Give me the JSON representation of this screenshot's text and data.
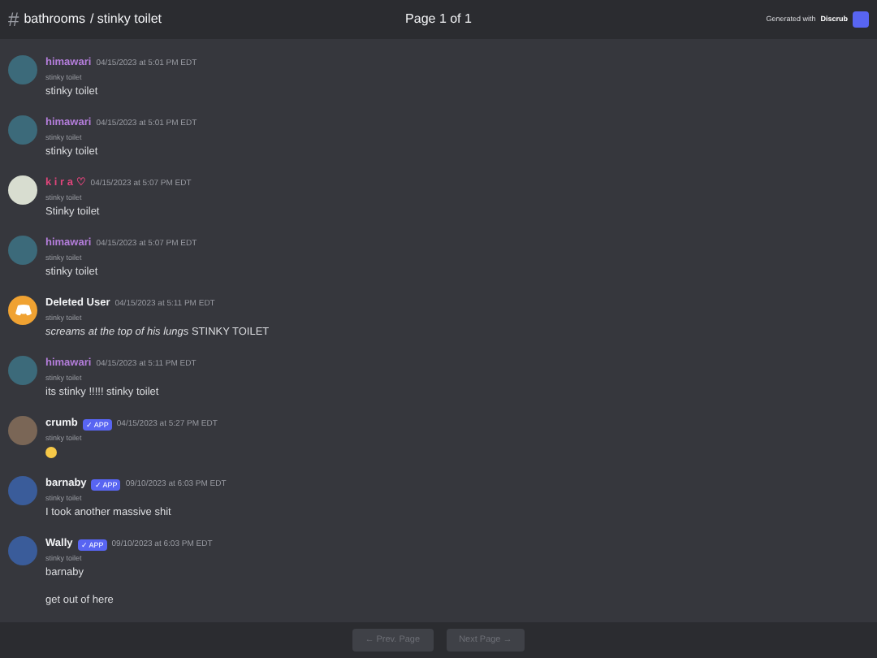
{
  "header": {
    "channel": "bathrooms",
    "thread": "/ stinky toilet",
    "hash": "#",
    "page": "Page 1 of 1",
    "generated": "Generated with",
    "brand": "Discrub"
  },
  "messages": [
    {
      "author": "himawari",
      "color": "#b57edc",
      "kind": "palm",
      "app": false,
      "time": "04/15/2023 at 5:01 PM EDT",
      "reply": "stinky toilet",
      "lines": [
        "stinky toilet"
      ]
    },
    {
      "author": "himawari",
      "color": "#b57edc",
      "kind": "palm",
      "app": false,
      "time": "04/15/2023 at 5:01 PM EDT",
      "reply": "stinky toilet",
      "lines": [
        "stinky toilet"
      ]
    },
    {
      "author": "k i r a ♡",
      "color": "#e0457b",
      "kind": "light",
      "app": false,
      "time": "04/15/2023 at 5:07 PM EDT",
      "reply": "stinky toilet",
      "lines": [
        "Stinky toilet"
      ]
    },
    {
      "author": "himawari",
      "color": "#b57edc",
      "kind": "palm",
      "app": false,
      "time": "04/15/2023 at 5:07 PM EDT",
      "reply": "stinky toilet",
      "lines": [
        "stinky toilet"
      ]
    },
    {
      "author": "Deleted User",
      "color": "#f2f3f5",
      "kind": "deleted",
      "app": false,
      "time": "04/15/2023 at 5:11 PM EDT",
      "reply": "stinky toilet",
      "lines": [
        "*screams at the top of his lungs* STINKY TOILET"
      ]
    },
    {
      "author": "himawari",
      "color": "#b57edc",
      "kind": "palm",
      "app": false,
      "time": "04/15/2023 at 5:11 PM EDT",
      "reply": "stinky toilet",
      "lines": [
        "its stinky !!!!! stinky toilet"
      ]
    },
    {
      "author": "crumb",
      "color": "#f2f3f5",
      "kind": "brown",
      "app": true,
      "badge": "✓ APP",
      "time": "04/15/2023 at 5:27 PM EDT",
      "reply": "stinky toilet",
      "emoji": true
    },
    {
      "author": "barnaby",
      "color": "#f2f3f5",
      "kind": "blue",
      "app": true,
      "badge": "✓ APP",
      "time": "09/10/2023 at 6:03 PM EDT",
      "reply": "stinky toilet",
      "lines": [
        "I took another massive shit"
      ]
    },
    {
      "author": "Wally",
      "color": "#f2f3f5",
      "kind": "blue",
      "app": true,
      "badge": "✓ APP",
      "time": "09/10/2023 at 6:03 PM EDT",
      "reply": "stinky toilet",
      "lines": [
        "barnaby",
        "get out of here"
      ]
    }
  ],
  "footer": {
    "prev": "← Prev. Page",
    "next": "Next Page →",
    "prev_disabled": true,
    "next_disabled": true
  }
}
